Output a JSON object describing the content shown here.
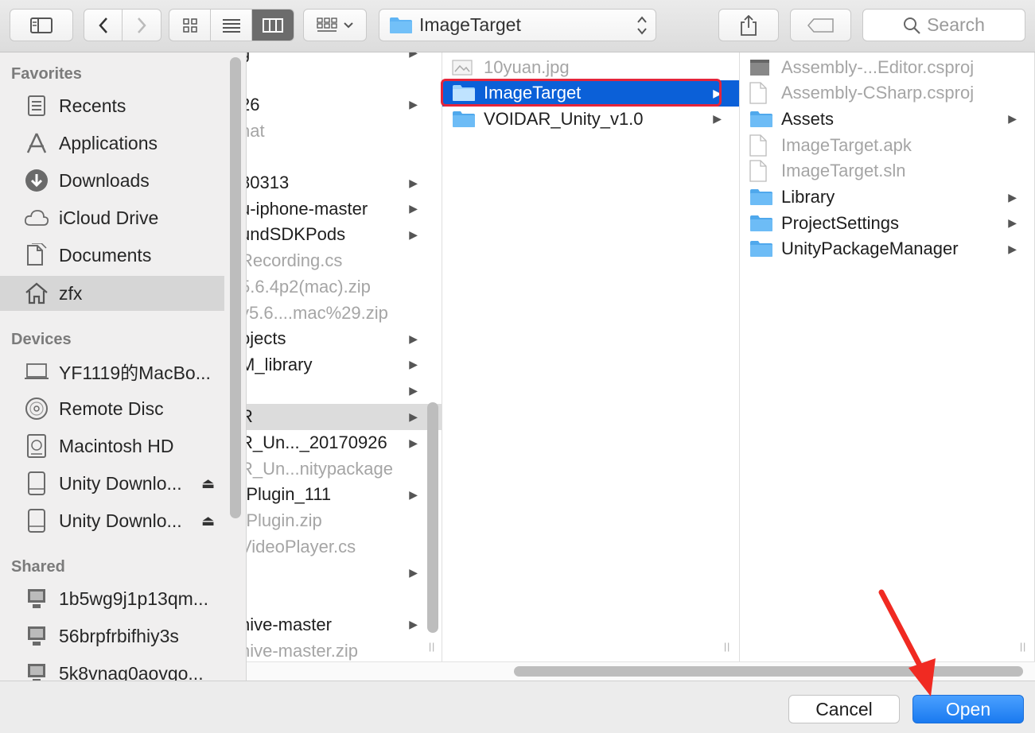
{
  "toolbar": {
    "path_label": "ImageTarget",
    "search_placeholder": "Search"
  },
  "sidebar": {
    "favorites_heading": "Favorites",
    "favorites": [
      "Recents",
      "Applications",
      "Downloads",
      "iCloud Drive",
      "Documents",
      "zfx"
    ],
    "devices_heading": "Devices",
    "devices": [
      "YF1119的MacBo...",
      "Remote Disc",
      "Macintosh HD",
      "Unity Downlo...",
      "Unity Downlo..."
    ],
    "shared_heading": "Shared",
    "shared": [
      "1b5wg9j1p13qm...",
      "56brpfrbifhiy3s",
      "5k8vnag0aovgo..."
    ]
  },
  "column1": [
    {
      "label": "g",
      "folder": true,
      "dim": false
    },
    {
      "label": "",
      "folder": false,
      "dim": false
    },
    {
      "label": "26",
      "folder": true,
      "dim": false
    },
    {
      "label": "hat",
      "folder": false,
      "dim": true
    },
    {
      "label": "",
      "folder": false,
      "dim": false
    },
    {
      "label": "80313",
      "folder": true,
      "dim": false
    },
    {
      "label": "u-iphone-master",
      "folder": true,
      "dim": false
    },
    {
      "label": "undSDKPods",
      "folder": true,
      "dim": false
    },
    {
      "label": "Recording.cs",
      "folder": false,
      "dim": true
    },
    {
      "label": "5.6.4p2(mac).zip",
      "folder": false,
      "dim": true
    },
    {
      "label": "y5.6....mac%29.zip",
      "folder": false,
      "dim": true
    },
    {
      "label": "ojects",
      "folder": true,
      "dim": false
    },
    {
      "label": "M_library",
      "folder": true,
      "dim": false
    },
    {
      "label": "",
      "folder": true,
      "dim": false
    },
    {
      "label": "R",
      "folder": true,
      "dim": false,
      "highlight": true
    },
    {
      "label": "R_Un..._20170926",
      "folder": true,
      "dim": false
    },
    {
      "label": "R_Un...nitypackage",
      "folder": false,
      "dim": true
    },
    {
      "label": "-Plugin_111",
      "folder": true,
      "dim": false
    },
    {
      "label": "-Plugin.zip",
      "folder": false,
      "dim": true
    },
    {
      "label": "VideoPlayer.cs",
      "folder": false,
      "dim": true
    },
    {
      "label": "",
      "folder": true,
      "dim": false
    },
    {
      "label": "",
      "folder": false,
      "dim": false
    },
    {
      "label": "hive-master",
      "folder": true,
      "dim": false
    },
    {
      "label": "hive-master.zip",
      "folder": false,
      "dim": true
    }
  ],
  "column2": [
    {
      "label": "10yuan.jpg",
      "type": "image",
      "dim": true
    },
    {
      "label": "ImageTarget",
      "type": "folder",
      "selected": true
    },
    {
      "label": "VOIDAR_Unity_v1.0",
      "type": "folder"
    }
  ],
  "column3": [
    {
      "label": "Assembly-...Editor.csproj",
      "type": "exec",
      "dim": true
    },
    {
      "label": "Assembly-CSharp.csproj",
      "type": "doc",
      "dim": true
    },
    {
      "label": "Assets",
      "type": "folder"
    },
    {
      "label": "ImageTarget.apk",
      "type": "doc",
      "dim": true
    },
    {
      "label": "ImageTarget.sln",
      "type": "doc",
      "dim": true
    },
    {
      "label": "Library",
      "type": "folder"
    },
    {
      "label": "ProjectSettings",
      "type": "folder"
    },
    {
      "label": "UnityPackageManager",
      "type": "folder"
    }
  ],
  "buttons": {
    "cancel": "Cancel",
    "open": "Open"
  },
  "colors": {
    "selection": "#0b60d8",
    "highlight_outline": "#e5253b",
    "folder": "#5fb4f4",
    "open_button": "#1a7af0"
  }
}
